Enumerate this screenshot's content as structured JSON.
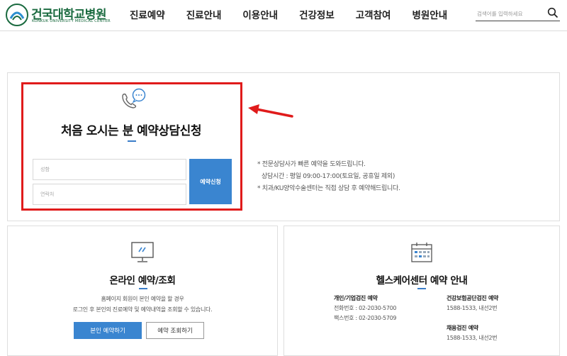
{
  "header": {
    "logo_kr": "건국대학교병원",
    "logo_en": "KONKUK UNIVERSITY MEDICAL CENTER",
    "nav": [
      "진료예약",
      "진료안내",
      "이용안내",
      "건강정보",
      "고객참여",
      "병원안내"
    ],
    "search_placeholder": "검색어를 입력하세요"
  },
  "consult": {
    "title": "처음 오시는 분 예약상담신청",
    "name_placeholder": "성함",
    "phone_placeholder": "연락처",
    "submit_label": "예약신청",
    "notes": [
      "* 전문상담사가 빠른 예약을 도와드립니다.",
      "상담시간 : 평일 09:00-17:00(토요일, 공휴일 제외)",
      "* 치과/KU양악수술센터는 직접 상담 후 예약해드립니다."
    ]
  },
  "online": {
    "title": "온라인 예약/조회",
    "desc": [
      "홈페이지 회원이 본인 예약을 할 경우",
      "로그인 후 본인의 진료예약 및 예약내역을 조회할 수 있습니다."
    ],
    "btn_reserve": "본인 예약하기",
    "btn_lookup": "예약 조회하기"
  },
  "healthcare": {
    "title": "헬스케어센터 예약 안내",
    "col1": {
      "head": "개인/기업검진 예약",
      "lines": [
        "전화번호 : 02-2030-5700",
        "팩스번호 : 02-2030-5709"
      ]
    },
    "col2": {
      "head": "건강보험공단검진 예약",
      "line": "1588-1533, 내선2번",
      "head2": "채용검진 예약",
      "line2": "1588-1533, 내선2번"
    }
  },
  "colors": {
    "accent_blue": "#3a85d0",
    "highlight_red": "#e01b1b",
    "logo_green": "#1a6a3f"
  }
}
